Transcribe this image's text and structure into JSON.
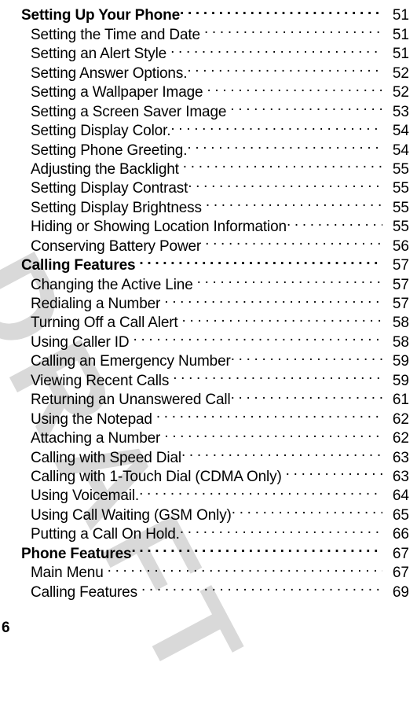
{
  "document": {
    "folio": "6",
    "watermark": "DRAFT",
    "watermark_color": "#d9d9d9"
  },
  "toc": {
    "entries": [
      {
        "label": "Setting Up Your Phone",
        "page": "51",
        "level": 1,
        "gap": "none"
      },
      {
        "label": "Setting the Time and Date",
        "page": "51",
        "level": 2,
        "gap": "small"
      },
      {
        "label": "Setting an Alert Style",
        "page": "51",
        "level": 2,
        "gap": "small"
      },
      {
        "label": "Setting Answer Options.",
        "page": "52",
        "level": 2,
        "gap": "none"
      },
      {
        "label": "Setting a Wallpaper Image",
        "page": "52",
        "level": 2,
        "gap": "small"
      },
      {
        "label": "Setting a Screen Saver Image",
        "page": "53",
        "level": 2,
        "gap": "small"
      },
      {
        "label": "Setting Display Color.",
        "page": "54",
        "level": 2,
        "gap": "none"
      },
      {
        "label": "Setting Phone Greeting.",
        "page": "54",
        "level": 2,
        "gap": "none"
      },
      {
        "label": "Adjusting the Backlight",
        "page": "55",
        "level": 2,
        "gap": "small"
      },
      {
        "label": "Setting Display Contrast",
        "page": "55",
        "level": 2,
        "gap": "none"
      },
      {
        "label": "Setting Display Brightness",
        "page": "55",
        "level": 2,
        "gap": "small"
      },
      {
        "label": "Hiding or Showing Location Information",
        "page": "55",
        "level": 2,
        "gap": "none"
      },
      {
        "label": "Conserving Battery Power",
        "page": "56",
        "level": 2,
        "gap": "small"
      },
      {
        "label": "Calling Features",
        "page": "57",
        "level": 1,
        "gap": "small"
      },
      {
        "label": "Changing the Active Line",
        "page": "57",
        "level": 2,
        "gap": "small"
      },
      {
        "label": "Redialing a Number",
        "page": "57",
        "level": 2,
        "gap": "small"
      },
      {
        "label": "Turning Off a Call Alert",
        "page": "58",
        "level": 2,
        "gap": "small"
      },
      {
        "label": "Using Caller ID",
        "page": "58",
        "level": 2,
        "gap": "small"
      },
      {
        "label": "Calling an Emergency Number",
        "page": "59",
        "level": 2,
        "gap": "none"
      },
      {
        "label": "Viewing Recent Calls",
        "page": "59",
        "level": 2,
        "gap": "small"
      },
      {
        "label": "Returning an Unanswered Call",
        "page": "61",
        "level": 2,
        "gap": "none"
      },
      {
        "label": "Using the Notepad",
        "page": "62",
        "level": 2,
        "gap": "small"
      },
      {
        "label": "Attaching a Number",
        "page": "62",
        "level": 2,
        "gap": "small"
      },
      {
        "label": "Calling with Speed Dial",
        "page": "63",
        "level": 2,
        "gap": "none"
      },
      {
        "label": "Calling with 1-Touch Dial (CDMA Only)",
        "page": "63",
        "level": 2,
        "gap": "small"
      },
      {
        "label": "Using Voicemail.",
        "page": "64",
        "level": 2,
        "gap": "none"
      },
      {
        "label": "Using Call Waiting (GSM Only)",
        "page": "65",
        "level": 2,
        "gap": "none"
      },
      {
        "label": "Putting a Call On Hold.",
        "page": "66",
        "level": 2,
        "gap": "none"
      },
      {
        "label": "Phone Features",
        "page": "67",
        "level": 1,
        "gap": "none"
      },
      {
        "label": "Main Menu",
        "page": "67",
        "level": 2,
        "gap": "small"
      },
      {
        "label": "Calling Features",
        "page": "69",
        "level": 2,
        "gap": "small"
      }
    ]
  }
}
